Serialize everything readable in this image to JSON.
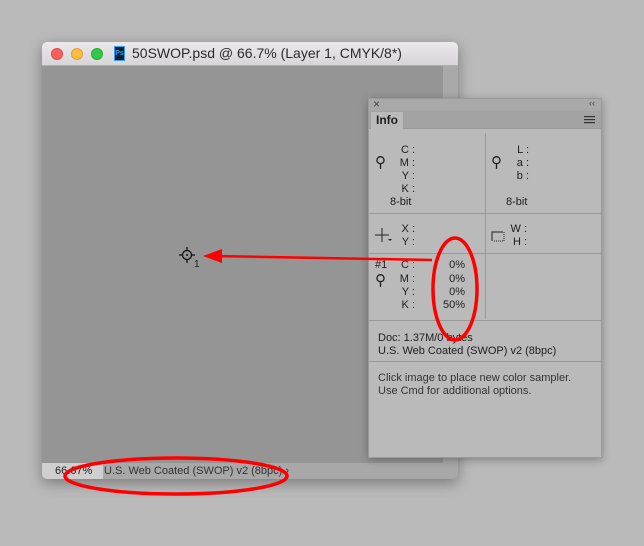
{
  "window": {
    "title": "50SWOP.psd @ 66.7% (Layer 1, CMYK/8*)",
    "app_icon": "Ps",
    "zoom": "66.67%",
    "profile": "U.S. Web Coated (SWOP) v2 (8bpc)",
    "profile_arrow": "›",
    "sampler_number": "1"
  },
  "panel": {
    "close": "×",
    "collapse": "‹‹",
    "tab": "Info",
    "cmyk_labels": [
      "C :",
      "M :",
      "Y :",
      "K :"
    ],
    "cmyk_bits": "8-bit",
    "lab_labels": [
      "L :",
      "a :",
      "b :"
    ],
    "lab_bits": "8-bit",
    "xy_labels": [
      "X :",
      "Y :"
    ],
    "wh_labels": [
      "W :",
      "H :"
    ],
    "sampler": {
      "id": "#1",
      "labels": [
        "C :",
        "M :",
        "Y :",
        "K :"
      ],
      "values": [
        "0%",
        "0%",
        "0%",
        "50%"
      ]
    },
    "doc": "Doc: 1.37M/0 bytes",
    "profile": "U.S. Web Coated (SWOP) v2 (8bpc)",
    "hint1": "Click image to place new color sampler.",
    "hint2": "Use Cmd for additional options."
  },
  "colors": {
    "annotation": "#ff0000"
  }
}
